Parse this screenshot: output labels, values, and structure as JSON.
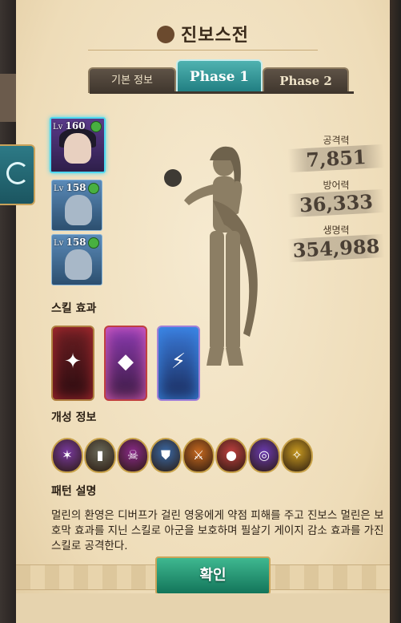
{
  "header": {
    "title": "진보스전"
  },
  "tabs": [
    {
      "label": "기본 정보",
      "active": false
    },
    {
      "label": "Phase 1",
      "active": true
    },
    {
      "label": "Phase 2",
      "active": false
    }
  ],
  "enemies": [
    {
      "lv_prefix": "Lv",
      "lv": "160",
      "selected": true
    },
    {
      "lv_prefix": "Lv",
      "lv": "158",
      "selected": false
    },
    {
      "lv_prefix": "Lv",
      "lv": "158",
      "selected": false
    }
  ],
  "stats": [
    {
      "label": "공격력",
      "value": "7,851"
    },
    {
      "label": "방어력",
      "value": "36,333"
    },
    {
      "label": "생명력",
      "value": "354,988"
    }
  ],
  "sections": {
    "skills": "스킬 효과",
    "traits": "개성 정보",
    "pattern": "패턴 설명"
  },
  "skill_cards": [
    {
      "icon": "red-strike-icon",
      "color": "#b02a30"
    },
    {
      "icon": "pink-cube-icon",
      "color": "#e060c0"
    },
    {
      "icon": "blue-lightning-icon",
      "color": "#3a8ae8"
    }
  ],
  "trait_badges": [
    {
      "icon": "purple-claw-icon",
      "color": "#7a3aa0"
    },
    {
      "icon": "gray-tablet-icon",
      "color": "#6a6a5a"
    },
    {
      "icon": "skull-icon",
      "color": "#8a2a8a"
    },
    {
      "icon": "shield-icon",
      "color": "#3a6aa8"
    },
    {
      "icon": "sword-icon",
      "color": "#c86a20"
    },
    {
      "icon": "orbs-icon",
      "color": "#c04040"
    },
    {
      "icon": "vortex-icon",
      "color": "#6a3ab0"
    },
    {
      "icon": "golden-wing-icon",
      "color": "#c89a20"
    }
  ],
  "description": "멀린의 환영은 디버프가 걸린 영웅에게 약점 피해를 주고 진보스 멀린은 보호막 효과를 지닌 스킬로 아군을 보호하며 필살기 게이지 감소 효과를 가진 스킬로 공격한다.",
  "confirm_label": "확인"
}
